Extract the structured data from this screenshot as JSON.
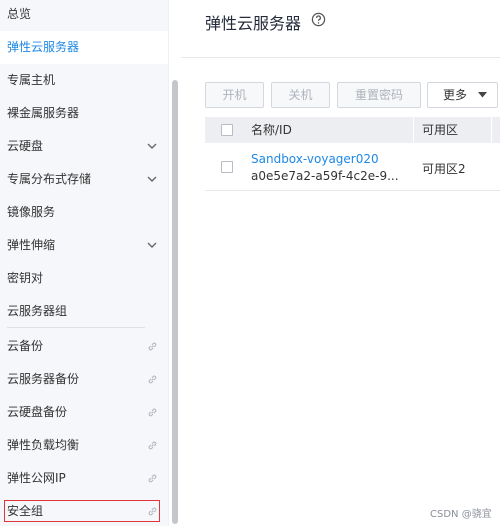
{
  "sidebar": {
    "items": [
      {
        "label": "总览"
      },
      {
        "label": "弹性云服务器"
      },
      {
        "label": "专属主机"
      },
      {
        "label": "裸金属服务器"
      },
      {
        "label": "云硬盘"
      },
      {
        "label": "专属分布式存储"
      },
      {
        "label": "镜像服务"
      },
      {
        "label": "弹性伸缩"
      },
      {
        "label": "密钥对"
      },
      {
        "label": "云服务器组"
      },
      {
        "label": "云备份"
      },
      {
        "label": "云服务器备份"
      },
      {
        "label": "云硬盘备份"
      },
      {
        "label": "弹性负载均衡"
      },
      {
        "label": "弹性公网IP"
      },
      {
        "label": "安全组"
      }
    ]
  },
  "header": {
    "title": "弹性云服务器"
  },
  "toolbar": {
    "start_label": "开机",
    "stop_label": "关机",
    "reset_password_label": "重置密码",
    "more_label": "更多"
  },
  "table": {
    "columns": [
      "名称/ID",
      "可用区"
    ],
    "rows": [
      {
        "name": "Sandbox-voyager020",
        "id": "a0e5e7a2-a59f-4c2e-9...",
        "az": "可用区2"
      }
    ]
  },
  "watermark": "CSDN @骁宜",
  "colors": {
    "accent": "#1e88e5",
    "highlight": "#e0353b",
    "sidebar_bg": "#f5f7fa"
  }
}
